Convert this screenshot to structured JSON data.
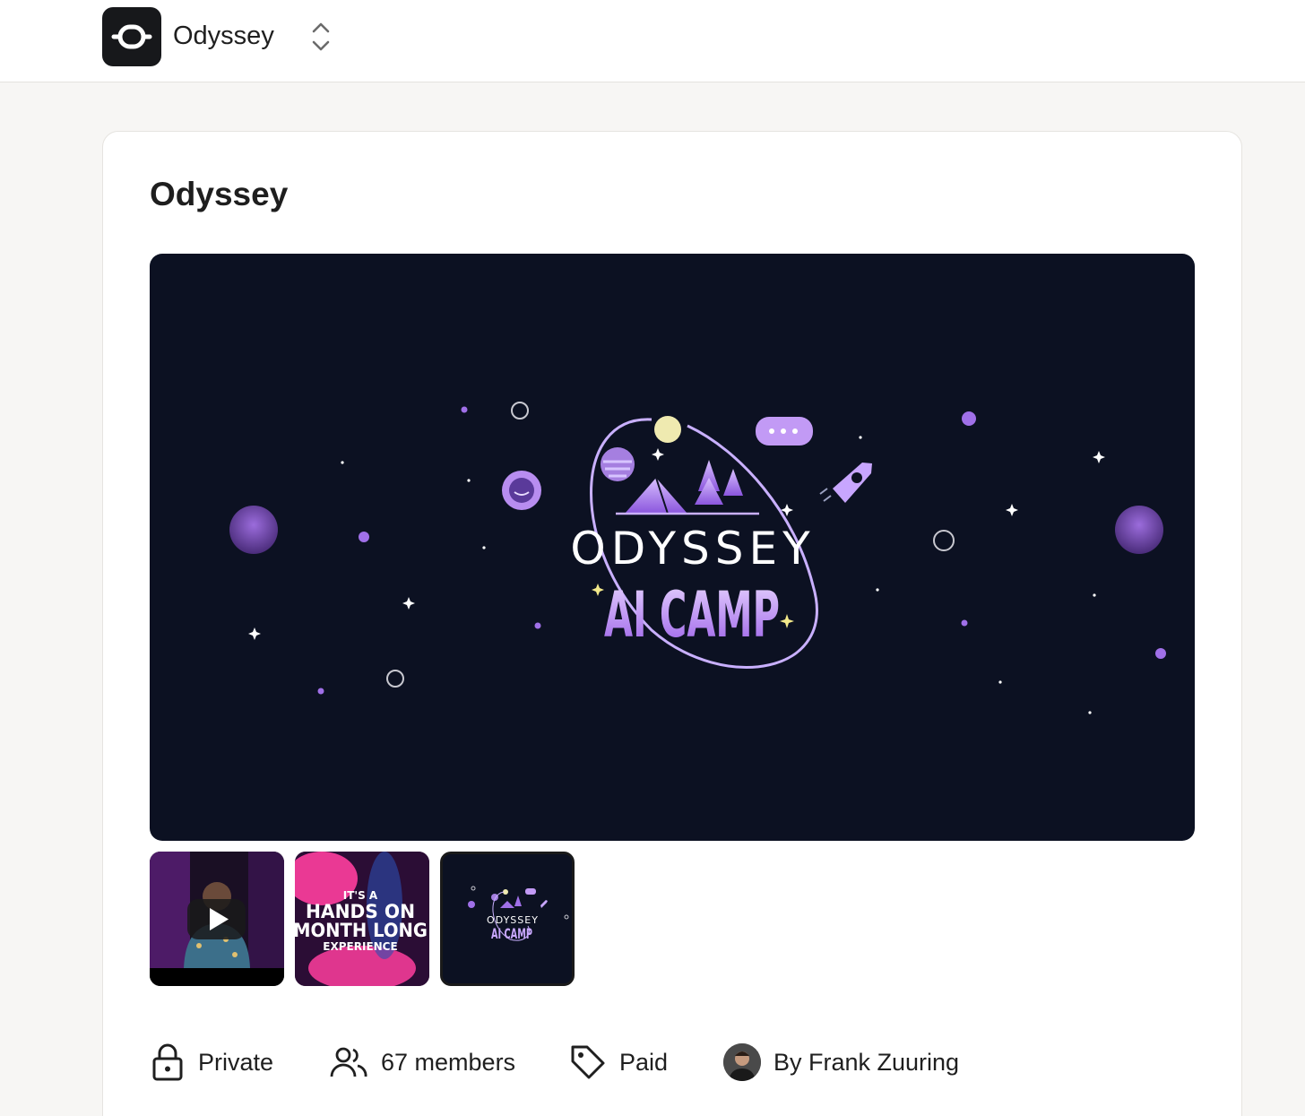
{
  "header": {
    "brand_name": "Odyssey",
    "logo_icon": "odyssey-logo-icon",
    "switcher_icon": "chevron-up-down-icon"
  },
  "community": {
    "title": "Odyssey",
    "hero": {
      "line1": "ODYSSEY",
      "line2": "AI CAMP"
    },
    "thumbnails": [
      {
        "kind": "video",
        "icon": "play-icon"
      },
      {
        "kind": "image",
        "line1": "IT'S A",
        "line2": "HANDS ON",
        "line3": "MONTH LONG",
        "line4": "EXPERIENCE"
      },
      {
        "kind": "image",
        "line1": "ODYSSEY",
        "line2": "AI CAMP"
      }
    ],
    "meta": {
      "privacy": "Private",
      "members": "67 members",
      "pricing": "Paid",
      "owner": "By Frank Zuuring"
    }
  },
  "colors": {
    "hero_bg": "#0c1122",
    "accent_purple": "#a070e8",
    "thumb_pink": "#ff3e9e"
  }
}
